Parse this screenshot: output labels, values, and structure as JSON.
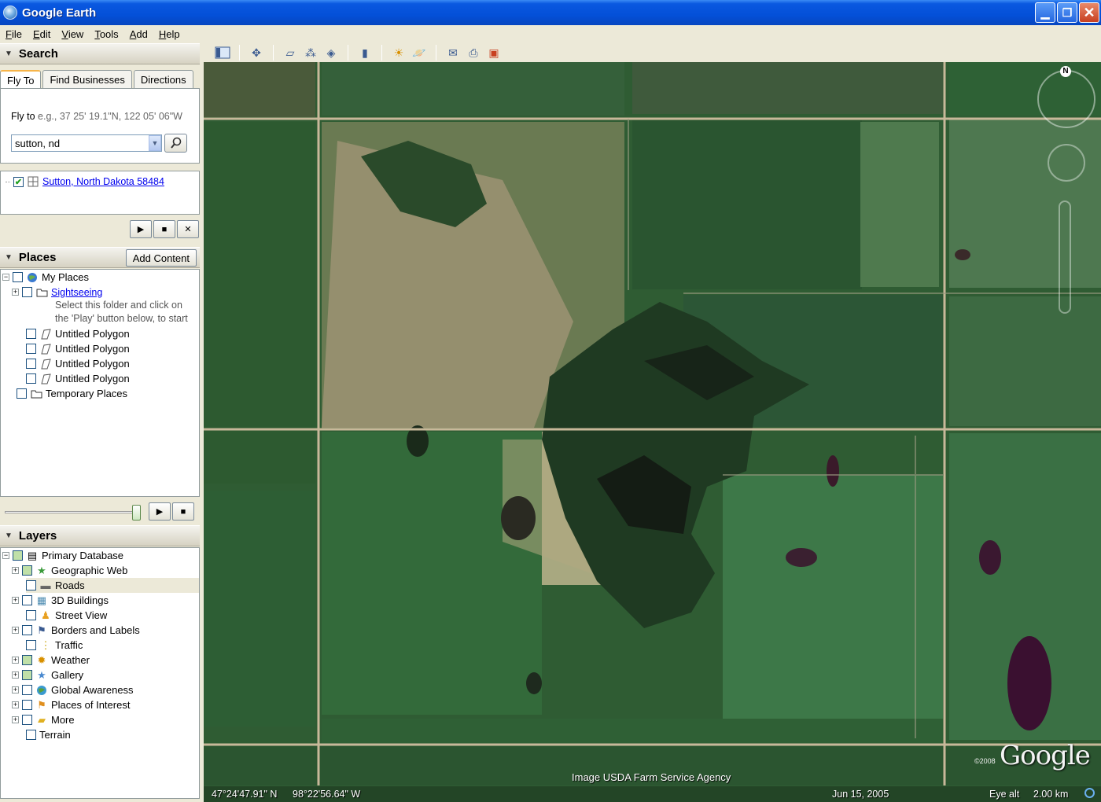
{
  "window": {
    "title": "Google Earth"
  },
  "menu": [
    "File",
    "Edit",
    "View",
    "Tools",
    "Add",
    "Help"
  ],
  "search": {
    "header": "Search",
    "tabs": [
      "Fly To",
      "Find Businesses",
      "Directions"
    ],
    "flyto_label": "Fly to",
    "flyto_hint": "e.g., 37 25' 19.1\"N, 122 05' 06\"W",
    "input_value": "sutton, nd",
    "result": "Sutton, North Dakota 58484"
  },
  "places": {
    "header": "Places",
    "add_content": "Add Content",
    "items": [
      {
        "label": "My Places"
      },
      {
        "label": "Sightseeing"
      },
      {
        "label": "Untitled Polygon"
      },
      {
        "label": "Untitled Polygon"
      },
      {
        "label": "Untitled Polygon"
      },
      {
        "label": "Untitled Polygon"
      },
      {
        "label": "Temporary Places"
      }
    ],
    "sightseeing_desc_1": "Select this folder and click on",
    "sightseeing_desc_2": "the 'Play' button below, to start"
  },
  "layers": {
    "header": "Layers",
    "items": [
      {
        "label": "Primary Database"
      },
      {
        "label": "Geographic Web"
      },
      {
        "label": "Roads"
      },
      {
        "label": "3D Buildings"
      },
      {
        "label": "Street View"
      },
      {
        "label": "Borders and Labels"
      },
      {
        "label": "Traffic"
      },
      {
        "label": "Weather"
      },
      {
        "label": "Gallery"
      },
      {
        "label": "Global Awareness"
      },
      {
        "label": "Places of Interest"
      },
      {
        "label": "More"
      },
      {
        "label": "Terrain"
      }
    ]
  },
  "map": {
    "attribution": "Image USDA Farm Service Agency",
    "latitude": "47°24'47.91\" N",
    "longitude": "98°22'56.64\" W",
    "date": "Jun 15, 2005",
    "eye_alt_label": "Eye alt",
    "eye_alt_value": "2.00 km",
    "logo": "Google",
    "copyright": "©2008",
    "north": "N"
  }
}
